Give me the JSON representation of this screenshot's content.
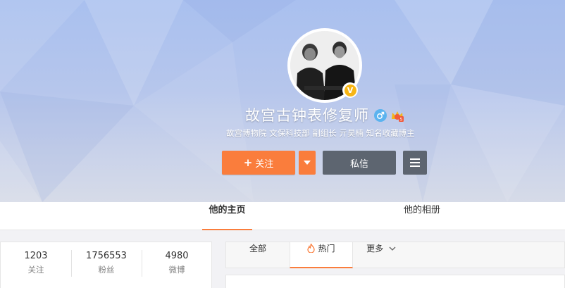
{
  "profile": {
    "name": "故宫古钟表修复师",
    "description": "故宫博物院 文保科技部 副组长 亓昊楠 知名收藏博主",
    "verified_badge": "V"
  },
  "actions": {
    "follow_label": "关注",
    "follow_plus": "+",
    "message_label": "私信"
  },
  "tabs": {
    "home": "他的主页",
    "album": "他的相册"
  },
  "stats": [
    {
      "value": "1203",
      "label": "关注"
    },
    {
      "value": "1756553",
      "label": "粉丝"
    },
    {
      "value": "4980",
      "label": "微博"
    }
  ],
  "feed_tabs": {
    "all": "全部",
    "hot": "热门",
    "more": "更多"
  },
  "colors": {
    "accent": "#fa7d3c",
    "dark_button": "#5d6570",
    "verified": "#f7b515",
    "male": "#5bb3ef"
  },
  "icons": [
    "avatar",
    "verified-icon",
    "male-icon",
    "crown-icon",
    "dropdown-arrow-icon",
    "menu-icon",
    "fire-icon",
    "chevron-down-icon"
  ]
}
